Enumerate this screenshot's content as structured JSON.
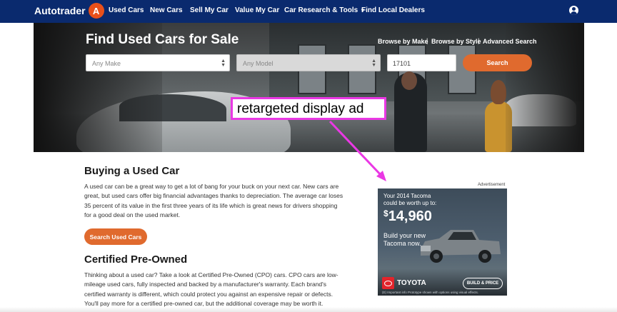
{
  "nav": {
    "logo_text": "Autotrader",
    "items": [
      {
        "label": "Used Cars"
      },
      {
        "label": "New Cars"
      },
      {
        "label": "Sell My Car"
      },
      {
        "label": "Value My Car"
      },
      {
        "label": "Car Research & Tools",
        "has_dropdown": true
      },
      {
        "label": "Find Local Dealers"
      }
    ],
    "dropdown_caret": "▾",
    "account_icon": "account-circle-icon",
    "background": "#0a2a6e"
  },
  "hero": {
    "title": "Find Used Cars for Sale",
    "browse_links": [
      "Browse by Make",
      "Browse by Style",
      "Advanced Search"
    ],
    "separator": "|",
    "make_select": {
      "value": "Any Make"
    },
    "model_select": {
      "value": "Any Model",
      "disabled": true
    },
    "zip_input": {
      "value": "17101"
    },
    "search_button": "Search",
    "accent": "#e06a2e"
  },
  "annotation": {
    "label": "retargeted display ad",
    "color": "#ea38e4"
  },
  "content": {
    "buying_heading": "Buying a Used Car",
    "buying_paragraph": "A used car can be a great way to get a lot of bang for your buck on your next car. New cars are great, but used cars offer big financial advantages thanks to depreciation. The average car loses 35 percent of its value in the first three years of its life which is great news for drivers shopping for a good deal on the used market.",
    "search_used_button": "Search Used Cars",
    "cpo_heading": "Certified Pre-Owned",
    "cpo_paragraph": "Thinking about a used car? Take a look at Certified Pre-Owned (CPO) cars. CPO cars are low-mileage used cars, fully inspected and backed by a manufacturer's warranty. Each brand's certified warranty is different, which could protect you against an expensive repair or defects. You'll pay more for a certified pre-owned car, but the additional coverage may be worth it."
  },
  "ad": {
    "label": "Advertisement",
    "line1": "Your 2014 Tacoma",
    "line2": "could be worth up to:",
    "price_prefix": "$",
    "price": "14,960",
    "build_line1": "Build your new",
    "build_line2": "Tacoma now.",
    "brand": "TOYOTA",
    "build_button": "BUILD & PRICE",
    "fine_print": "(E) Important info    Prototype shown with options using visual effects.",
    "brand_color": "#e3242b"
  }
}
